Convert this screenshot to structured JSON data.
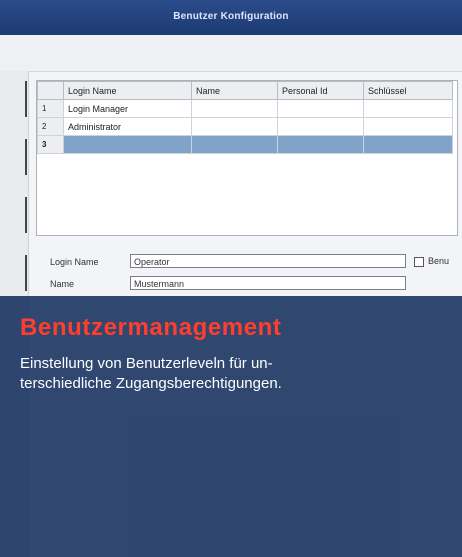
{
  "window": {
    "title": "Benutzer Konfiguration"
  },
  "table": {
    "headers": [
      "Login Name",
      "Name",
      "Personal Id",
      "Schlüssel"
    ],
    "rows": [
      {
        "num": "1",
        "login": "Login Manager",
        "name": "",
        "pid": "",
        "key": ""
      },
      {
        "num": "2",
        "login": "Administrator",
        "name": "",
        "pid": "",
        "key": ""
      },
      {
        "num": "3",
        "login": "",
        "name": "",
        "pid": "",
        "key": ""
      }
    ]
  },
  "form": {
    "login_label": "Login Name",
    "login_value": "Operator",
    "name_label": "Name",
    "name_value": "Mustermann",
    "checkbox_label": "Benu"
  },
  "overlay": {
    "headline": "Benutzermanagement",
    "line1": "Einstellung von Benutzerleveln für un-",
    "line2": "terschiedliche Zugangsberechtigungen."
  },
  "colors": {
    "accent": "#ff3e2e",
    "overlay": "#0f2a5a",
    "selected_row": "#7fa3c9"
  }
}
